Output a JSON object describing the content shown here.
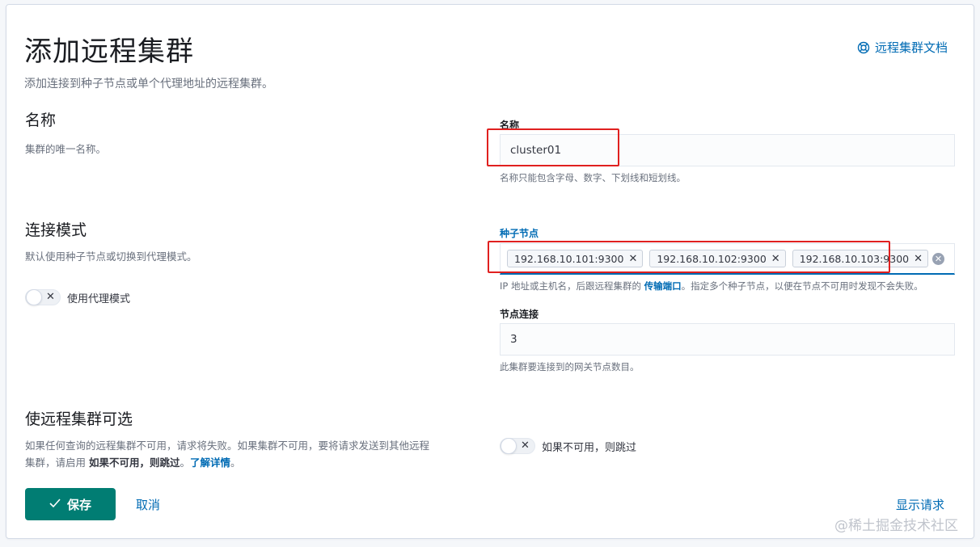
{
  "header": {
    "title": "添加远程集群",
    "subtitle": "添加连接到种子节点或单个代理地址的远程集群。",
    "doc_link": "远程集群文档"
  },
  "name_section": {
    "title": "名称",
    "description": "集群的唯一名称。",
    "field_label": "名称",
    "field_value": "cluster01",
    "help": "名称只能包含字母、数字、下划线和短划线。"
  },
  "connection_section": {
    "title": "连接模式",
    "description": "默认使用种子节点或切换到代理模式。",
    "proxy_toggle_label": "使用代理模式",
    "seed_label": "种子节点",
    "seeds": [
      "192.168.10.101:9300",
      "192.168.10.102:9300",
      "192.168.10.103:9300"
    ],
    "seed_help_prefix": "IP 地址或主机名，后跟远程集群的 ",
    "seed_help_link": "传输端口",
    "seed_help_suffix": "。指定多个种子节点，以便在节点不可用时发现不会失败。",
    "node_conn_label": "节点连接",
    "node_conn_value": "3",
    "node_conn_help": "此集群要连接到的网关节点数目。"
  },
  "optional_section": {
    "title": "使远程集群可选",
    "description_line1": "如果任何查询的远程集群不可用，请求将失败。如果集群不可用，要将请求发送到其他远程",
    "description_line2_prefix": "集群，请启用 ",
    "description_bold": "如果不可用，则跳过",
    "description_sep": "。",
    "learn_more": "了解详情",
    "description_end": "。",
    "skip_toggle_label": "如果不可用，则跳过"
  },
  "footer": {
    "save": "保存",
    "cancel": "取消",
    "show_request": "显示请求"
  },
  "watermark": "@稀土掘金技术社区",
  "colors": {
    "primary": "#006bb4",
    "save_button": "#017d73",
    "highlight_box": "#e0201f"
  }
}
